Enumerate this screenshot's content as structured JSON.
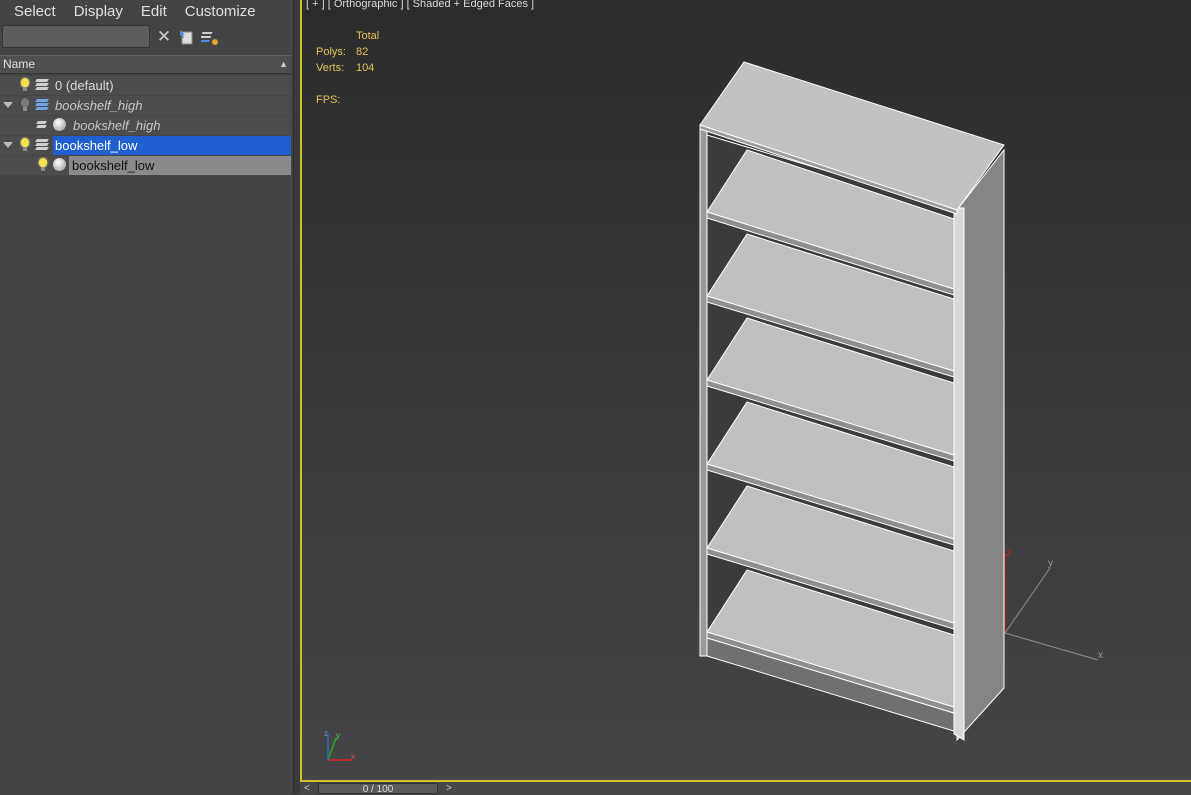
{
  "menu": [
    "Select",
    "Display",
    "Edit",
    "Customize"
  ],
  "search": {
    "placeholder": ""
  },
  "toolbar": {
    "clear_icon": "close-icon",
    "select_icon": "select-objects-icon",
    "layers_icon": "layers-manager-icon"
  },
  "column_header": {
    "name": "Name",
    "sort_icon": "▲"
  },
  "tree": [
    {
      "label": "0 (default)"
    },
    {
      "label": "bookshelf_high"
    },
    {
      "label": "bookshelf_high"
    },
    {
      "label": "bookshelf_low"
    },
    {
      "label": "bookshelf_low"
    }
  ],
  "viewport": {
    "label": "[ + ] [ Orthographic ] [ Shaded + Edged Faces ]",
    "stats": {
      "total_label": "Total",
      "polys_label": "Polys:",
      "polys_value": "82",
      "verts_label": "Verts:",
      "verts_value": "104",
      "fps_label": "FPS:"
    },
    "axis_x": "x",
    "axis_y": "y",
    "axis_z": "z"
  },
  "timeline": {
    "position": "0 / 100",
    "prev": "<",
    "next": ">"
  },
  "colors": {
    "selection_blue": "#1f5fcf",
    "active_viewport_border": "#d2c22a",
    "stats_text": "#e5c25a"
  }
}
